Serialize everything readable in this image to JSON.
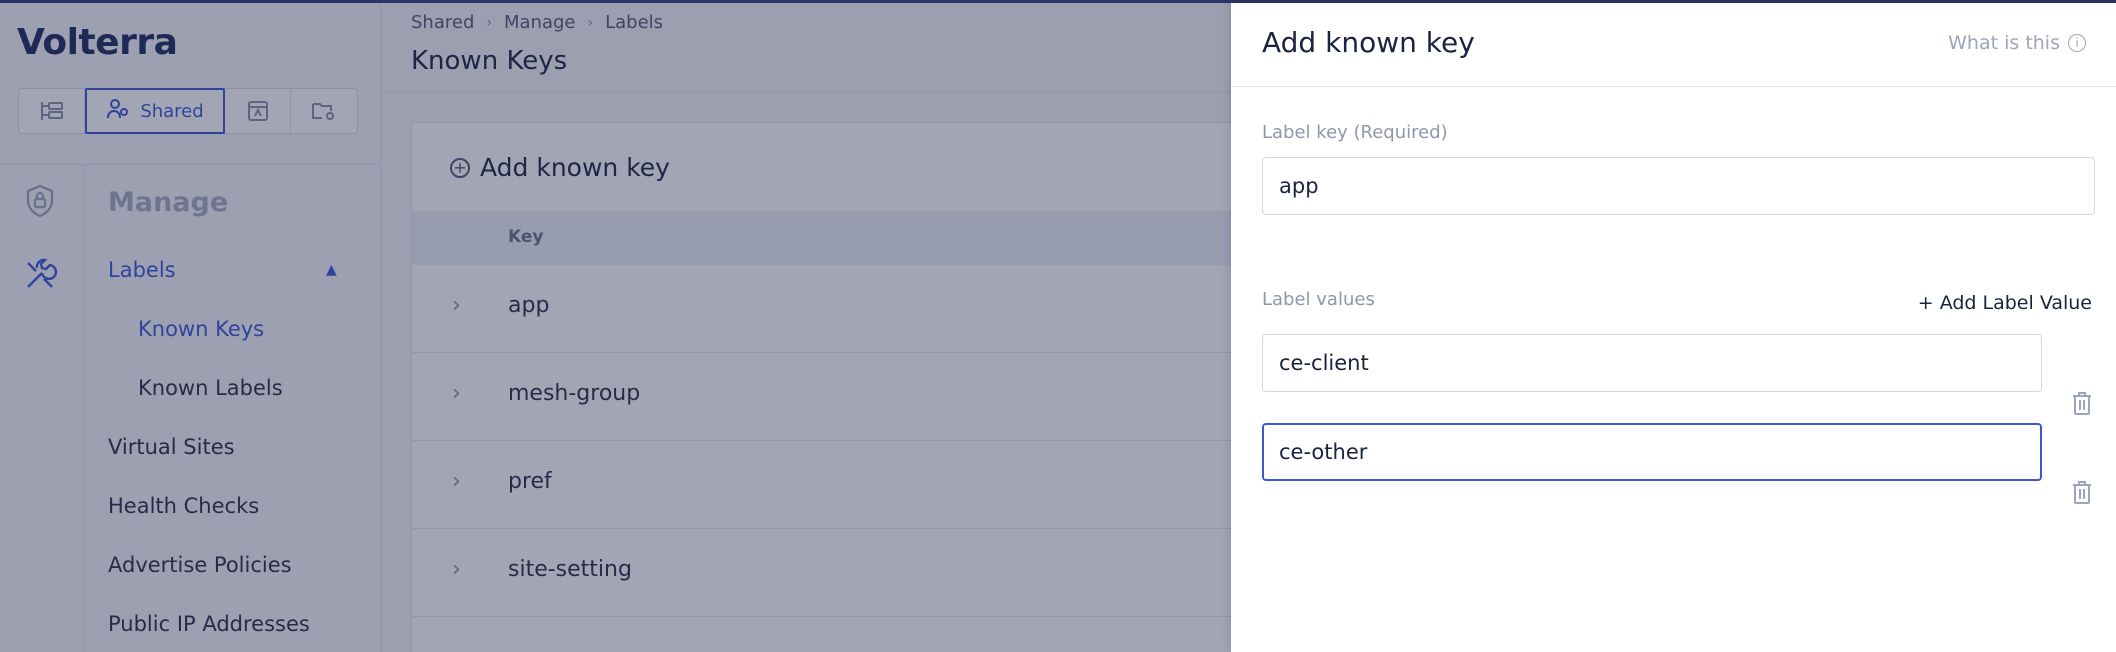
{
  "brand": {
    "logo_text": "Volterra"
  },
  "workspace_switcher": {
    "active_label": "Shared",
    "items": [
      "tree-icon",
      "users-icon",
      "namespace-icon",
      "folder-gear-icon"
    ]
  },
  "sidebar": {
    "section_title": "Manage",
    "items": [
      {
        "label": "Labels",
        "active": true,
        "expanded": true
      },
      {
        "label": "Known Keys",
        "active": true,
        "sub": true
      },
      {
        "label": "Known Labels",
        "sub": true
      },
      {
        "label": "Virtual Sites"
      },
      {
        "label": "Health Checks"
      },
      {
        "label": "Advertise Policies"
      },
      {
        "label": "Public IP Addresses"
      }
    ]
  },
  "breadcrumb": [
    "Shared",
    "Manage",
    "Labels"
  ],
  "page": {
    "title": "Known Keys",
    "add_button_label": "Add known key",
    "table": {
      "columns": [
        "Key"
      ],
      "rows": [
        "app",
        "mesh-group",
        "pref",
        "site-setting"
      ]
    }
  },
  "drawer": {
    "title": "Add known key",
    "help_text": "What is this",
    "label_key": {
      "label": "Label key (Required)",
      "value": "app"
    },
    "label_values": {
      "label": "Label values",
      "add_button": "+ Add Label Value",
      "values": [
        "ce-client",
        "ce-other"
      ]
    }
  },
  "colors": {
    "accent": "#3c57d6",
    "overlay": "#21284c",
    "brand": "#1c2a5c"
  }
}
